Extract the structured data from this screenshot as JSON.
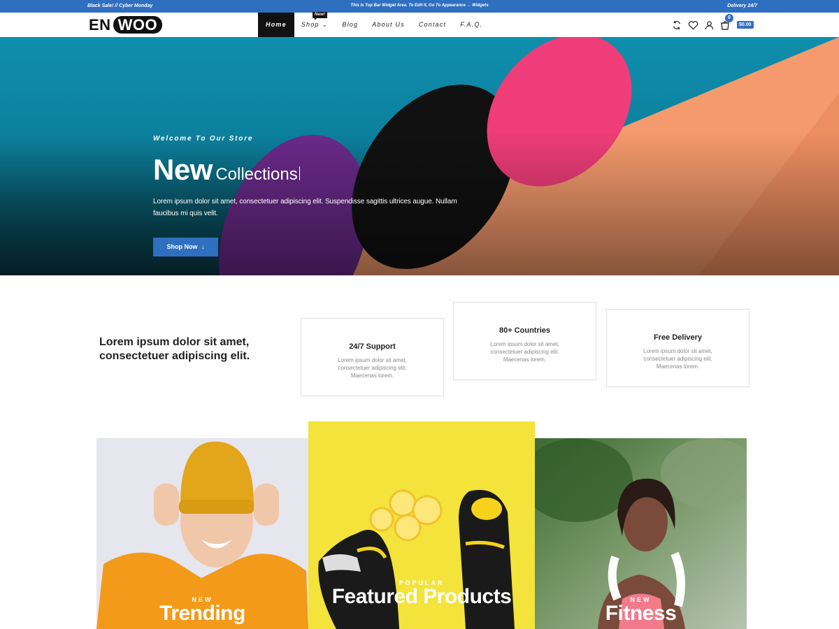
{
  "topbar": {
    "left": "Black Sale! // Cyber Monday",
    "center": "This Is Top Bar Widget Area. To Edit It, Go To Appearance → Widgets",
    "right": "Delivery 24/7"
  },
  "logo": {
    "part1": "EN",
    "part2": "WOO"
  },
  "nav": {
    "items": [
      {
        "label": "Home",
        "active": true
      },
      {
        "label": "Shop",
        "badge": "New!"
      },
      {
        "label": "Blog"
      },
      {
        "label": "About Us"
      },
      {
        "label": "Contact"
      },
      {
        "label": "F.A.Q."
      }
    ]
  },
  "header_icons": {
    "icons": [
      "compare-icon",
      "heart-icon",
      "user-icon",
      "cart-icon"
    ],
    "cart_count": "0",
    "cart_total": "$0.00"
  },
  "hero": {
    "subtitle": "Welcome To Our Store",
    "title_big": "New",
    "title_small": "Collections",
    "text": "Lorem ipsum dolor sit amet, consectetuer adipiscing elit. Suspendisse sagittis ultrices augue. Nullam faucibus mi quis velit.",
    "button": "Shop Now",
    "colors": {
      "teal": "#0f8fad",
      "peach": "#f59a6c",
      "purple": "#6a2a8a",
      "pink": "#ee3d78",
      "black": "#111111"
    }
  },
  "features": {
    "intro": "Lorem ipsum dolor sit amet, consectetuer adipiscing elit.",
    "boxes": [
      {
        "title": "24/7 Support",
        "text": "Lorem ipsum dolor sit amet, consectetuer adipiscing elit. Maecenas lorem."
      },
      {
        "title": "80+ Countries",
        "text": "Lorem ipsum dolor sit amet, consectetuer adipiscing elit. Maecenas lorem."
      },
      {
        "title": "Free Delivery",
        "text": "Lorem ipsum dolor sit amet, consectetuer adipiscing elit. Maecenas lorem."
      }
    ]
  },
  "cards": [
    {
      "small": "NEW",
      "big": "Trending"
    },
    {
      "small": "POPULAR",
      "big": "Featured Products"
    },
    {
      "small": "NEW",
      "big": "Fitness"
    }
  ],
  "colors": {
    "accent": "#2f6fc0",
    "dark": "#111111",
    "yellow": "#f4e33a"
  }
}
